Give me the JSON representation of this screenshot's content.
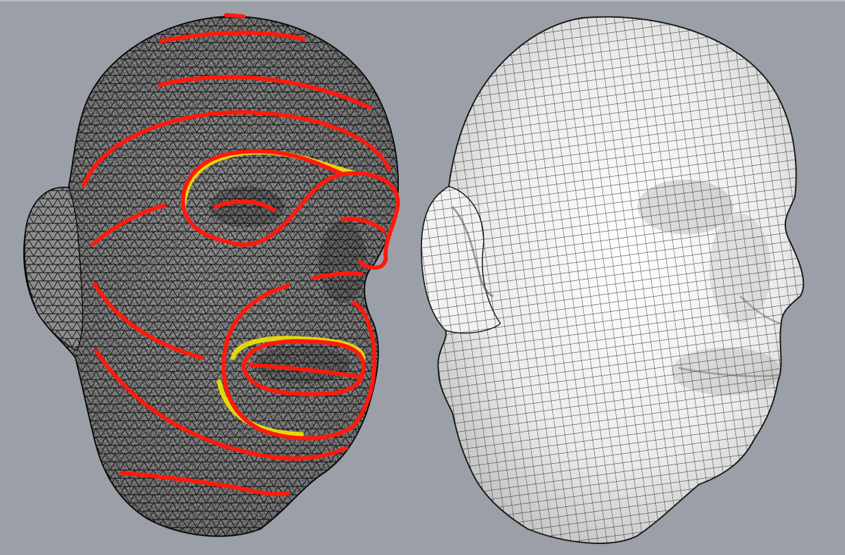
{
  "scene": {
    "background_color": "#9ba0a8",
    "left_model": {
      "kind": "triangulated-scan-mesh",
      "wire_color": "#111111",
      "feature_curve_color": "#ff1a0d",
      "feature_curve_highlight": "#f2e600"
    },
    "right_model": {
      "kind": "quad-remeshed-surface",
      "surface_color": "#f4f4f4",
      "wire_color": "#1a1a1a"
    }
  }
}
